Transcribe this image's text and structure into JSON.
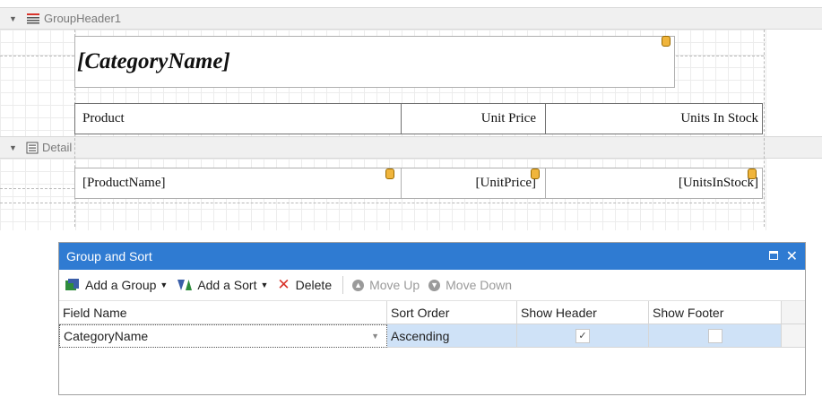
{
  "designer": {
    "group_header_band": "GroupHeader1",
    "detail_band": "Detail",
    "category_field": "[CategoryName]",
    "col_headers": [
      "Product",
      "Unit Price",
      "Units In Stock"
    ],
    "detail_fields": [
      "[ProductName]",
      "[UnitPrice]",
      "[UnitsInStock]"
    ]
  },
  "panel": {
    "title": "Group and Sort",
    "toolbar": {
      "add_group": "Add a Group",
      "add_sort": "Add a Sort",
      "delete": "Delete",
      "move_up": "Move Up",
      "move_down": "Move Down"
    },
    "columns": [
      "Field Name",
      "Sort Order",
      "Show Header",
      "Show Footer"
    ],
    "rows": [
      {
        "field_name": "CategoryName",
        "sort_order": "Ascending",
        "show_header": true,
        "show_footer": false
      }
    ]
  },
  "colors": {
    "title_bar": "#2f7bd2",
    "selected_row": "#cfe2f7",
    "db_icon": "#f0b53c"
  }
}
